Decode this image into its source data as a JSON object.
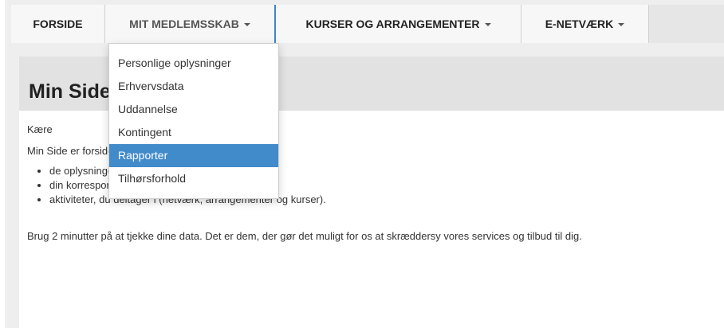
{
  "nav": {
    "items": [
      {
        "label": "FORSIDE"
      },
      {
        "label": "MIT MEDLEMSSKAB"
      },
      {
        "label": "KURSER OG ARRANGEMENTER"
      },
      {
        "label": "E-NETVÆRK"
      }
    ]
  },
  "dropdown": {
    "items": [
      {
        "label": "Personlige oplysninger"
      },
      {
        "label": "Erhvervsdata"
      },
      {
        "label": "Uddannelse"
      },
      {
        "label": "Kontingent"
      },
      {
        "label": "Rapporter"
      },
      {
        "label": "Tilhørsforhold"
      }
    ],
    "active_color": "#428bca"
  },
  "page": {
    "title": "Min Side",
    "greeting": "Kære",
    "intro": "Min Side er forsiden for dine data. Her kan du se:",
    "bullets": [
      "de oplysninger, vi har om dig",
      "din korrespondance med os",
      "aktiviteter, du deltager i (netværk, arrangementer og kurser)."
    ],
    "closing": "Brug 2 minutter på at tjekke dine data. Det er dem, der gør det muligt for os at skræddersy vores services og tilbud til dig."
  }
}
